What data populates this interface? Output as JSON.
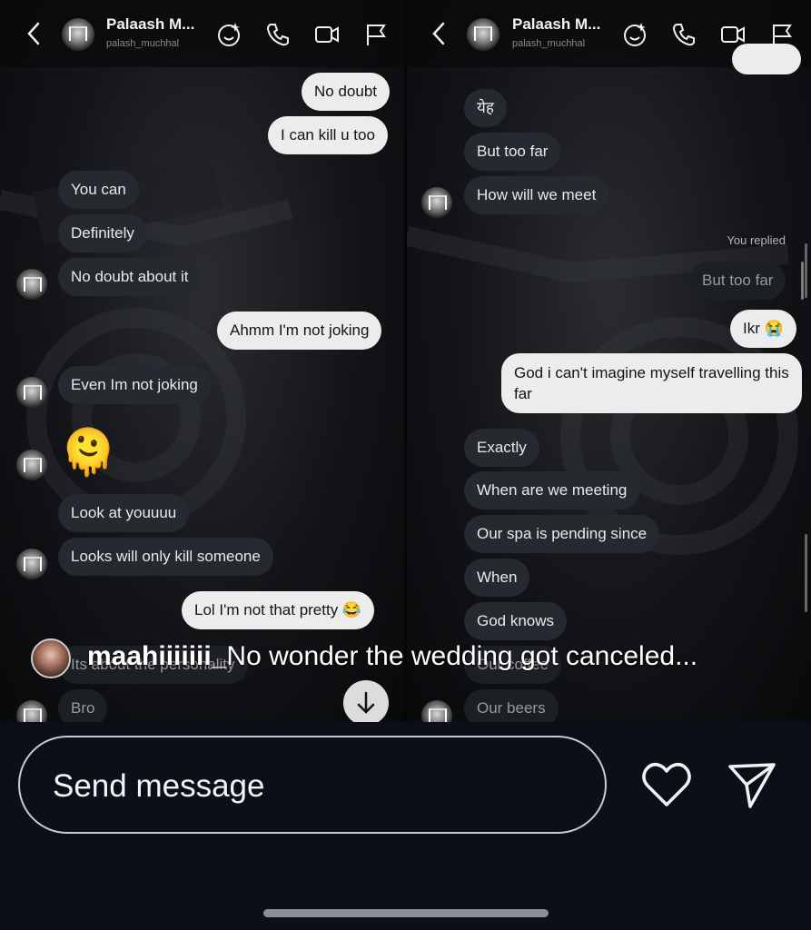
{
  "left_panel": {
    "header": {
      "name": "Palaash M...",
      "username": "palash_muchhal"
    },
    "messages": [
      {
        "text": "No doubt",
        "dir": "out"
      },
      {
        "text": "I can kill u too",
        "dir": "out"
      },
      {
        "text": "You can",
        "dir": "in"
      },
      {
        "text": "Definitely",
        "dir": "in"
      },
      {
        "text": "No doubt about it",
        "dir": "in"
      },
      {
        "text": "Ahmm I'm not joking",
        "dir": "out"
      },
      {
        "text": "Even Im not joking",
        "dir": "in"
      },
      {
        "text": "🫠",
        "dir": "in"
      },
      {
        "text": "Look at youuuu",
        "dir": "in"
      },
      {
        "text": "Looks will only kill someone",
        "dir": "in"
      },
      {
        "text": "Lol I'm not that pretty 😂",
        "dir": "out"
      },
      {
        "text": "Its about the personality",
        "dir": "in"
      },
      {
        "text": "Bro",
        "dir": "in"
      }
    ]
  },
  "right_panel": {
    "header": {
      "name": "Palaash M...",
      "username": "palash_muchhal"
    },
    "replied_label": "You replied",
    "messages": [
      {
        "text": "येह",
        "dir": "in"
      },
      {
        "text": "But too far",
        "dir": "in"
      },
      {
        "text": "How will we meet",
        "dir": "in"
      },
      {
        "text": "But too far",
        "dir": "reply-quote"
      },
      {
        "text": "Ikr 😭",
        "dir": "out"
      },
      {
        "text": "God i can't imagine myself travelling this far",
        "dir": "out"
      },
      {
        "text": "Exactly",
        "dir": "in"
      },
      {
        "text": "When are we meeting",
        "dir": "in"
      },
      {
        "text": "Our spa is pending since",
        "dir": "in"
      },
      {
        "text": "When",
        "dir": "in"
      },
      {
        "text": "God knows",
        "dir": "in"
      },
      {
        "text": "Our coffee",
        "dir": "in"
      },
      {
        "text": "Our beers",
        "dir": "in"
      }
    ]
  },
  "comment": {
    "username": "maahiiiiiii_",
    "text": "No wonder the wedding got canceled..."
  },
  "composer": {
    "placeholder": "Send message"
  },
  "icons": {
    "back": "chevron-left-icon",
    "effects": "sparkle-face-icon",
    "call": "phone-icon",
    "video": "video-camera-icon",
    "report": "flag-icon",
    "like": "heart-icon",
    "share": "paper-plane-icon",
    "scroll": "arrow-down-icon"
  }
}
